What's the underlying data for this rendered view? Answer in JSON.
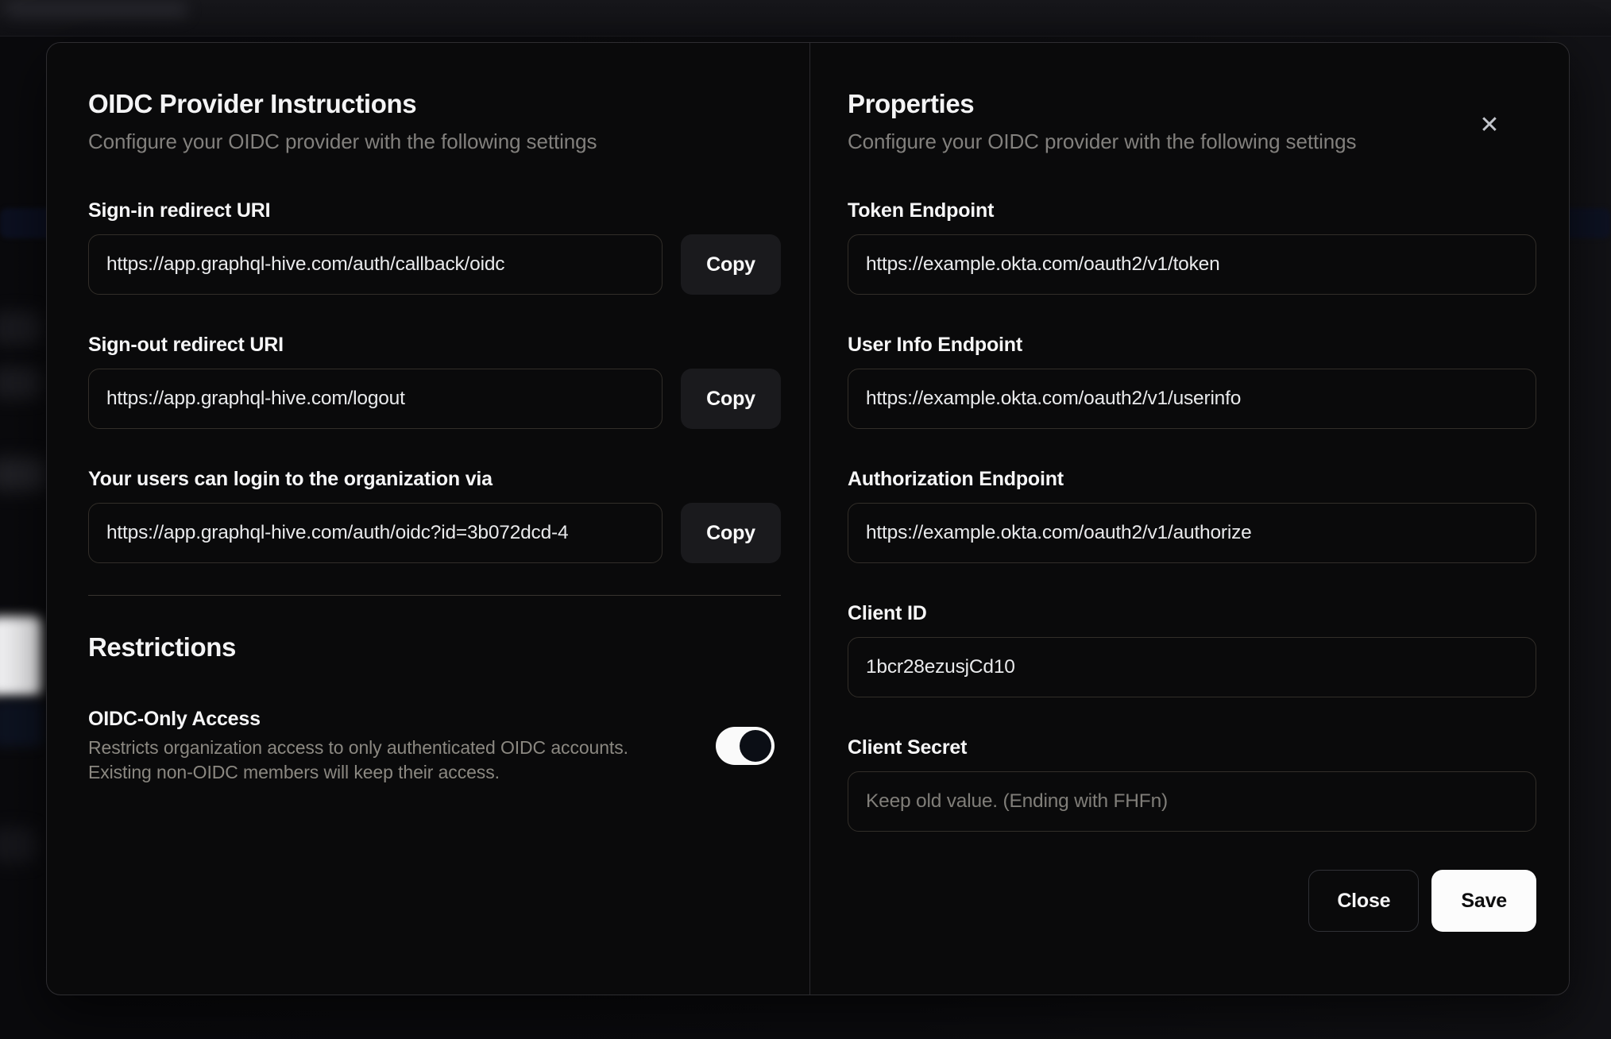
{
  "modal": {
    "close_icon_glyph": "✕",
    "left": {
      "title": "OIDC Provider Instructions",
      "subtitle": "Configure your OIDC provider with the following settings",
      "fields": [
        {
          "label": "Sign-in redirect URI",
          "value": "https://app.graphql-hive.com/auth/callback/oidc",
          "copy_label": "Copy"
        },
        {
          "label": "Sign-out redirect URI",
          "value": "https://app.graphql-hive.com/logout",
          "copy_label": "Copy"
        },
        {
          "label": "Your users can login to the organization via",
          "value": "https://app.graphql-hive.com/auth/oidc?id=3b072dcd-4",
          "copy_label": "Copy"
        }
      ],
      "restrictions": {
        "title": "Restrictions",
        "toggle_label": "OIDC-Only Access",
        "toggle_description_line1": "Restricts organization access to only authenticated OIDC accounts.",
        "toggle_description_line2": "Existing non-OIDC members will keep their access.",
        "toggle_state": "on"
      }
    },
    "right": {
      "title": "Properties",
      "subtitle": "Configure your OIDC provider with the following settings",
      "fields": [
        {
          "label": "Token Endpoint",
          "value": "https://example.okta.com/oauth2/v1/token"
        },
        {
          "label": "User Info Endpoint",
          "value": "https://example.okta.com/oauth2/v1/userinfo"
        },
        {
          "label": "Authorization Endpoint",
          "value": "https://example.okta.com/oauth2/v1/authorize"
        },
        {
          "label": "Client ID",
          "value": "1bcr28ezusjCd10"
        },
        {
          "label": "Client Secret",
          "value": "",
          "placeholder": "Keep old value. (Ending with FHFn)"
        }
      ],
      "footer": {
        "close_label": "Close",
        "save_label": "Save"
      }
    }
  },
  "colors": {
    "page_background": "#0c0c0f",
    "modal_background": "#0a0a0b",
    "modal_border": "#2e2d31",
    "input_border": "#322e29",
    "input_text": "#e9eaec",
    "placeholder_text": "#807e79",
    "muted_text": "#82807d",
    "copy_button_background": "#1a1a1d",
    "divider": "#383430",
    "toggle_track_on": "#fafafa",
    "toggle_knob": "#0b0e15",
    "save_button_background": "#fcfcfc",
    "save_button_text": "#0d0d0e"
  }
}
